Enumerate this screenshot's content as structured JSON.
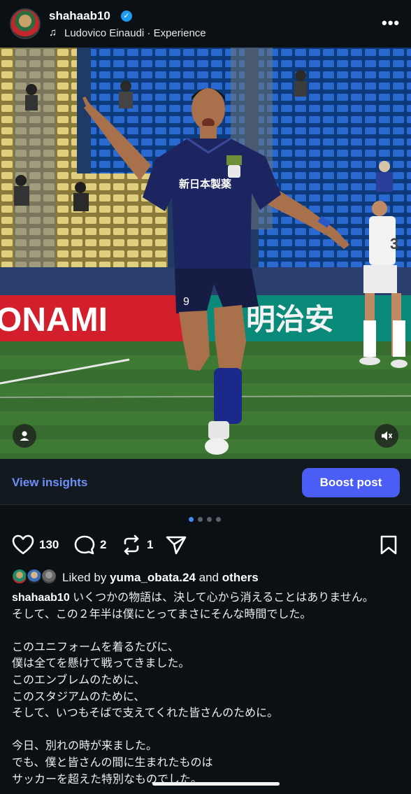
{
  "header": {
    "username": "shahaab10",
    "music_icon": "music-note-icon",
    "music": "Ludovico Einaudi · Experience",
    "more_icon": "more-options-icon",
    "more_label": "•••"
  },
  "photo": {
    "banner_left": "ONAMI",
    "banner_right": "明治安",
    "sponsor": "新日本製薬",
    "shorts_number": "9",
    "opponent_number": "3",
    "tag_icon": "person-tag-icon",
    "sound_icon": "speaker-muted-icon"
  },
  "insights": {
    "view_label": "View insights",
    "boost_label": "Boost post"
  },
  "carousel": {
    "total": 4,
    "active": 1
  },
  "actions": {
    "likes": "130",
    "comments": "2",
    "reposts": "1"
  },
  "likes_line": {
    "prefix": "Liked by",
    "user": "yuma_obata.24",
    "and": "and",
    "others": "others"
  },
  "caption": {
    "user": "shahaab10",
    "text": " いくつかの物語は、決して心から消えることはありません。\nそして、この２年半は僕にとってまさにそんな時間でした。\n\nこのユニフォームを着るたびに、\n僕は全てを懸けて戦ってきました。\nこのエンブレムのために、\nこのスタジアムのために、\nそして、いつもそばで支えてくれた皆さんのために。\n\n今日、別れの時が来ました。\nでも、僕と皆さんの間に生まれたものは\nサッカーを超えた特別なものでした。"
  },
  "colors": {
    "background": "#0b1014",
    "accent": "#4a5ef5",
    "link": "#6f8ef7",
    "verified": "#1d9bf0"
  }
}
